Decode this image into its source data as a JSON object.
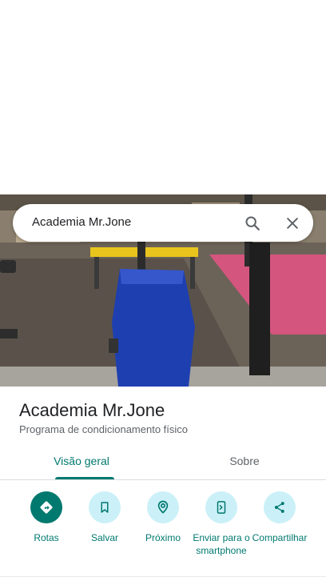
{
  "search": {
    "query": "Academia Mr.Jone",
    "search_icon": "search-icon",
    "close_icon": "close-icon"
  },
  "place": {
    "name": "Academia Mr.Jone",
    "category": "Programa de condicionamento físico"
  },
  "tabs": [
    {
      "label": "Visão geral",
      "selected": true
    },
    {
      "label": "Sobre",
      "selected": false
    }
  ],
  "actions": [
    {
      "label": "Rotas",
      "icon": "directions-icon"
    },
    {
      "label": "Salvar",
      "icon": "bookmark-icon"
    },
    {
      "label": "Próximo",
      "icon": "nearby-icon"
    },
    {
      "label": "Enviar para o smartphone",
      "icon": "send-to-phone-icon"
    },
    {
      "label": "Compartilhar",
      "icon": "share-icon"
    }
  ],
  "colors": {
    "accent": "#01796f",
    "action_bg": "#cbf0f8",
    "secondary_text": "#5f6368"
  }
}
